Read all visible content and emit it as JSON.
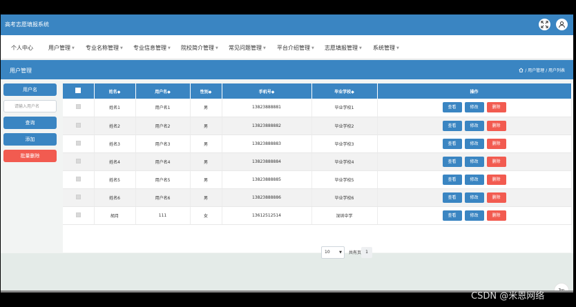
{
  "app": {
    "title": "高考志愿填报系统"
  },
  "nav": {
    "items": [
      {
        "label": "个人中心"
      },
      {
        "label": "用户管理"
      },
      {
        "label": "专业名称管理"
      },
      {
        "label": "专业信息管理"
      },
      {
        "label": "院校简介管理"
      },
      {
        "label": "常见问题管理"
      },
      {
        "label": "平台介绍管理"
      },
      {
        "label": "志愿填报管理"
      },
      {
        "label": "系统管理"
      }
    ]
  },
  "page": {
    "title": "用户管理",
    "breadcrumb": "/ 用户管理 / 用户列表"
  },
  "sidebar": {
    "field_label": "用户名",
    "input_placeholder": "请输入用户名",
    "query_label": "查询",
    "add_label": "添加",
    "batch_delete_label": "批量删除"
  },
  "table": {
    "headers": [
      "",
      "姓名◆",
      "用户名◆",
      "性别◆",
      "手机号◆",
      "毕业学校◆",
      "操作"
    ],
    "rows": [
      {
        "name": "姓名1",
        "username": "用户名1",
        "gender": "男",
        "phone": "13823888881",
        "school": "毕业学校1"
      },
      {
        "name": "姓名2",
        "username": "用户名2",
        "gender": "男",
        "phone": "13823888882",
        "school": "毕业学校2"
      },
      {
        "name": "姓名3",
        "username": "用户名3",
        "gender": "男",
        "phone": "13823888883",
        "school": "毕业学校3"
      },
      {
        "name": "姓名4",
        "username": "用户名4",
        "gender": "男",
        "phone": "13823888884",
        "school": "毕业学校4"
      },
      {
        "name": "姓名5",
        "username": "用户名5",
        "gender": "男",
        "phone": "13823888885",
        "school": "毕业学校5"
      },
      {
        "name": "姓名6",
        "username": "用户名6",
        "gender": "男",
        "phone": "13823888886",
        "school": "毕业学校6"
      },
      {
        "name": "胡月",
        "username": "111",
        "gender": "女",
        "phone": "13612512514",
        "school": "深圳中学"
      }
    ],
    "actions": {
      "view": "查看",
      "edit": "修改",
      "delete": "删除"
    }
  },
  "pager": {
    "page_size": "10",
    "total_label": "共有页",
    "current_page": "1"
  },
  "back_to_top": "Top",
  "watermark": "CSDN @米恩网络",
  "colors": {
    "primary": "#3a85c2",
    "danger": "#f25b50"
  }
}
